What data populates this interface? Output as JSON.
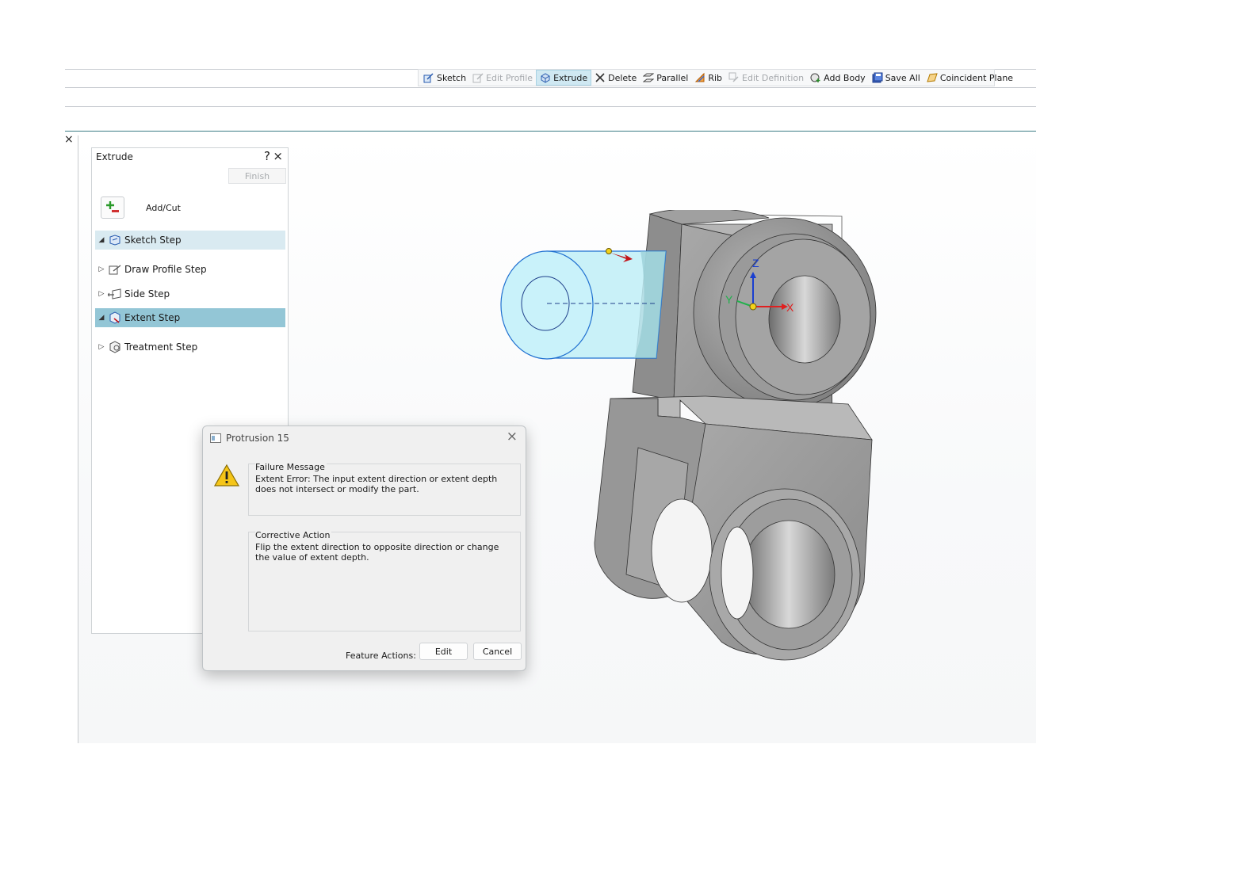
{
  "toolbar": {
    "items": [
      {
        "label": "Sketch",
        "icon": "sketch-icon",
        "state": "enabled"
      },
      {
        "label": "Edit Profile",
        "icon": "edit-profile-icon",
        "state": "disabled"
      },
      {
        "label": "Extrude",
        "icon": "extrude-icon",
        "state": "active"
      },
      {
        "label": "Delete",
        "icon": "delete-icon",
        "state": "enabled"
      },
      {
        "label": "Parallel",
        "icon": "parallel-icon",
        "state": "enabled"
      },
      {
        "label": "Rib",
        "icon": "rib-icon",
        "state": "enabled"
      },
      {
        "label": "Edit Definition",
        "icon": "edit-definition-icon",
        "state": "disabled"
      },
      {
        "label": "Add Body",
        "icon": "add-body-icon",
        "state": "enabled"
      },
      {
        "label": "Save All",
        "icon": "save-all-icon",
        "state": "enabled"
      },
      {
        "label": "Coincident Plane",
        "icon": "coincident-plane-icon",
        "state": "enabled"
      }
    ]
  },
  "workarea": {
    "close_glyph": "×"
  },
  "panel": {
    "title": "Extrude",
    "help": "?",
    "close": "×",
    "finish_label": "Finish",
    "addcut_label": "Add/Cut",
    "steps": [
      {
        "label": "Sketch Step",
        "expanded": true,
        "highlight": "light"
      },
      {
        "label": "Draw Profile Step",
        "expanded": false,
        "highlight": "none"
      },
      {
        "label": "Side Step",
        "expanded": false,
        "highlight": "none"
      },
      {
        "label": "Extent Step",
        "expanded": true,
        "highlight": "dark"
      },
      {
        "label": "Treatment Step",
        "expanded": false,
        "highlight": "none"
      }
    ]
  },
  "dialog": {
    "title": "Protrusion 15",
    "close": "×",
    "failure_heading": "Failure Message",
    "failure_text": "Extent Error: The input extent direction or extent depth does not intersect or modify the part.",
    "corrective_heading": "Corrective Action",
    "corrective_text": "Flip the extent direction to opposite direction or change the value of extent depth.",
    "feature_actions_label": "Feature Actions:",
    "edit_label": "Edit",
    "cancel_label": "Cancel"
  },
  "triad": {
    "x": "X",
    "y": "Y",
    "z": "Z"
  },
  "colors": {
    "accent_light": "#d9eaf1",
    "accent_dark": "#93c6d6",
    "preview_fill": "#bfeef7",
    "preview_edge": "#1e6fd0",
    "axis_x": "#e02020",
    "axis_y": "#22b14c",
    "axis_z": "#1a3fd0"
  }
}
